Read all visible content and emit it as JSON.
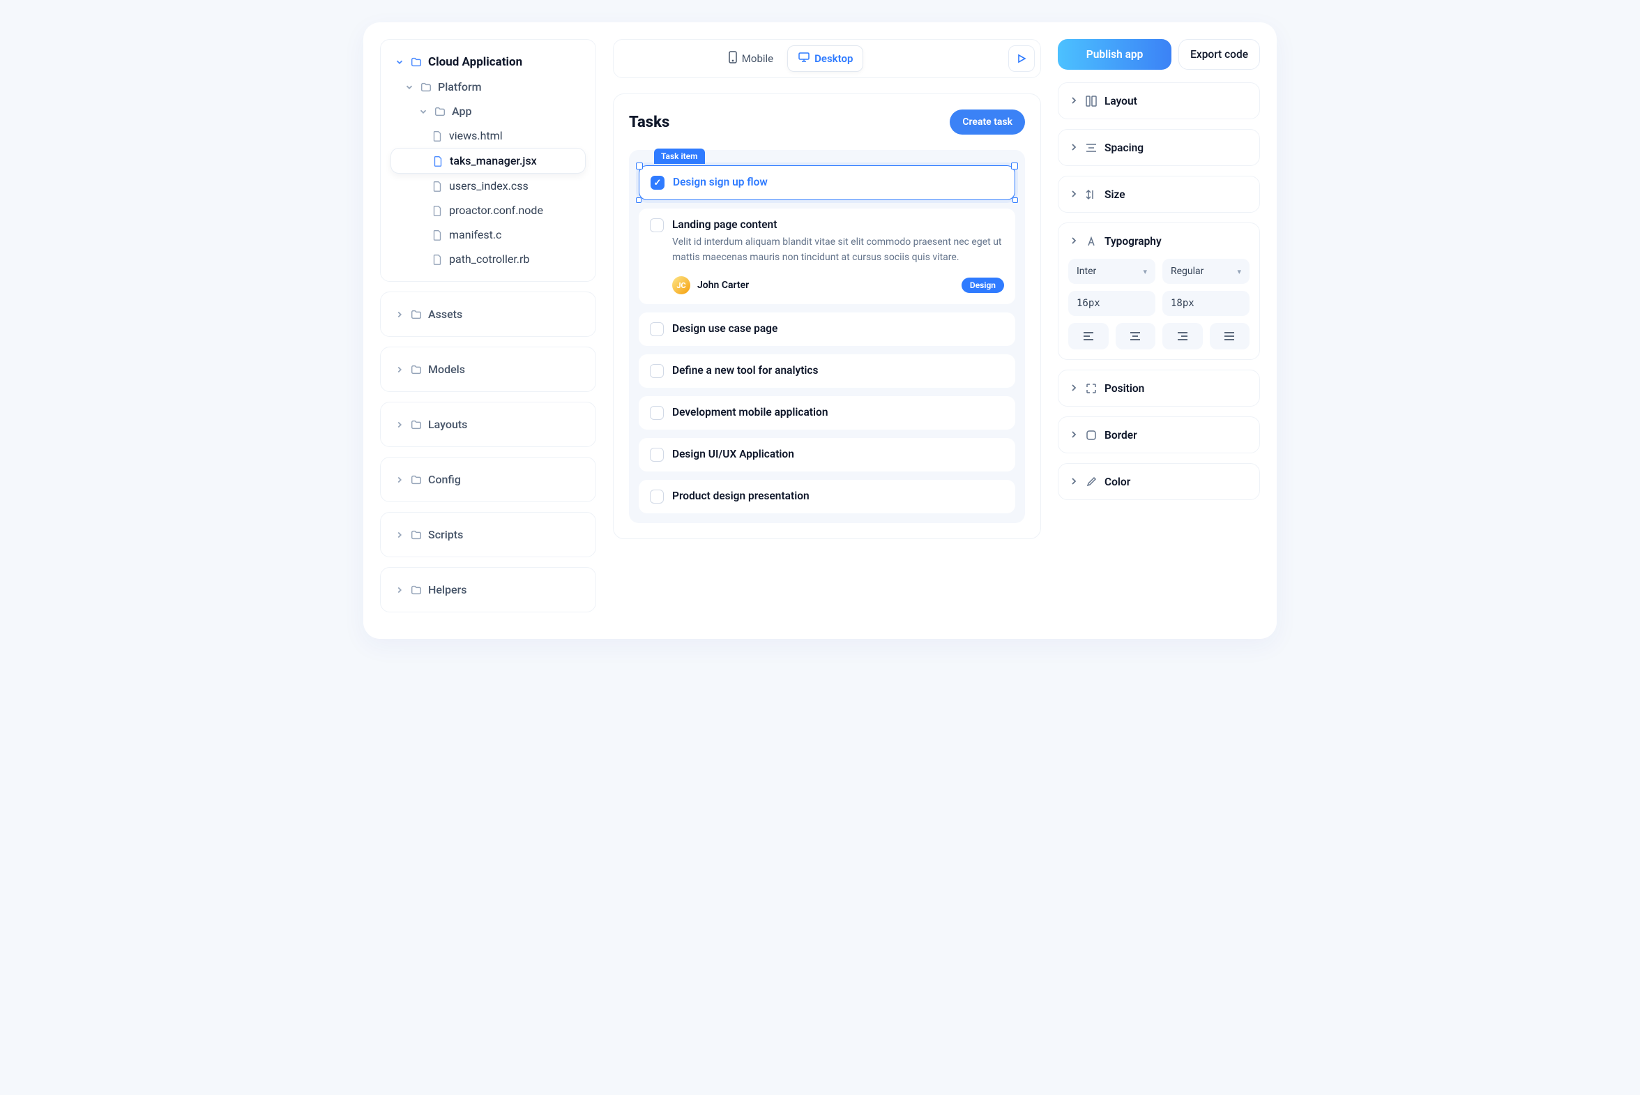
{
  "sidebar": {
    "root": "Cloud Application",
    "platform": "Platform",
    "app": "App",
    "files": [
      "views.html",
      "taks_manager.jsx",
      "users_index.css",
      "proactor.conf.node",
      "manifest.c",
      "path_cotroller.rb"
    ],
    "folders": [
      "Assets",
      "Models",
      "Layouts",
      "Config",
      "Scripts",
      "Helpers"
    ]
  },
  "toolbar": {
    "mobile": "Mobile",
    "desktop": "Desktop"
  },
  "preview": {
    "title": "Tasks",
    "create": "Create task",
    "selected_label": "Task item",
    "tasks": [
      {
        "title": "Design sign up flow",
        "checked": true,
        "selected": true
      },
      {
        "title": "Landing page content",
        "desc": "Velit id interdum aliquam blandit vitae sit elit commodo praesent nec eget ut mattis maecenas mauris non tincidunt at cursus sociis quis vitare.",
        "assignee": "John Carter",
        "initials": "JC",
        "tag": "Design"
      },
      {
        "title": "Design use case page"
      },
      {
        "title": "Define a new tool for analytics"
      },
      {
        "title": "Development mobile application"
      },
      {
        "title": "Design UI/UX Application"
      },
      {
        "title": "Product design presentation"
      }
    ]
  },
  "inspector": {
    "publish": "Publish app",
    "export": "Export code",
    "sections": {
      "layout": "Layout",
      "spacing": "Spacing",
      "size": "Size",
      "typography": "Typography",
      "position": "Position",
      "border": "Border",
      "color": "Color"
    },
    "typography": {
      "font": "Inter",
      "weight": "Regular",
      "size": "16px",
      "lineheight": "18px"
    }
  }
}
